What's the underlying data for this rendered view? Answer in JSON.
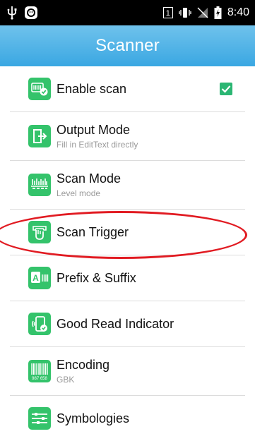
{
  "status_bar": {
    "time": "8:40",
    "sim_slot": "1",
    "icons": [
      "usb-icon",
      "mascot-icon",
      "vibrate-icon",
      "no-signal-icon",
      "battery-charging-icon"
    ]
  },
  "app_bar": {
    "title": "Scanner"
  },
  "colors": {
    "accent": "#3aa7e2",
    "icon_green": "#34c36b",
    "highlight": "#e11b22",
    "check": "#2bb673"
  },
  "items": [
    {
      "title": "Enable scan",
      "subtitle": "",
      "icon": "barcode-check-icon",
      "checked": true
    },
    {
      "title": "Output Mode",
      "subtitle": "Fill in EditText directly",
      "icon": "output-icon"
    },
    {
      "title": "Scan Mode",
      "subtitle": "Level mode",
      "icon": "scan-mode-icon"
    },
    {
      "title": "Scan Trigger",
      "subtitle": "",
      "icon": "trigger-hand-icon"
    },
    {
      "title": "Prefix & Suffix",
      "subtitle": "",
      "icon": "prefix-suffix-icon"
    },
    {
      "title": "Good Read Indicator",
      "subtitle": "",
      "icon": "good-read-icon"
    },
    {
      "title": "Encoding",
      "subtitle": "GBK",
      "icon": "encoding-barcode-icon",
      "icon_text": "987 658"
    },
    {
      "title": "Symbologies",
      "subtitle": "",
      "icon": "symbologies-icon"
    }
  ]
}
